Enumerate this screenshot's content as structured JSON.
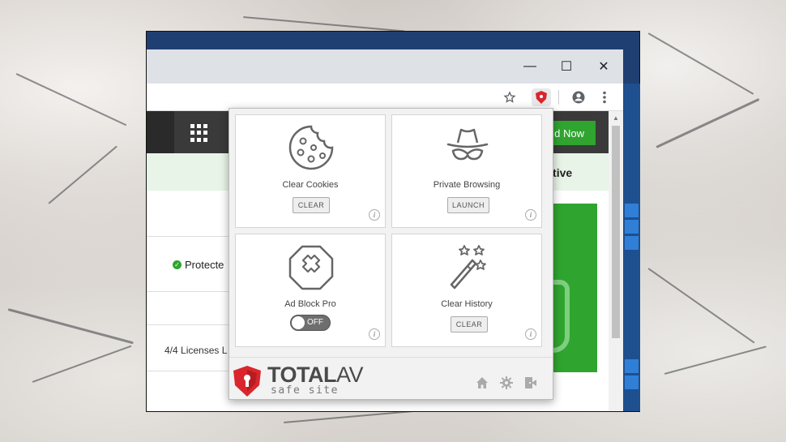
{
  "browser": {
    "window_controls": {
      "minimize": "—",
      "maximize": "☐",
      "close": "✕"
    },
    "toolbar_icons": [
      "star-icon",
      "totalav-extension-icon",
      "account-icon",
      "more-menu-icon"
    ]
  },
  "site": {
    "buy_button_partial": "d Now",
    "status_partial": "s Active",
    "protected_partial": "Protecte",
    "licenses_partial": "4/4 Licenses L"
  },
  "popup": {
    "cards": [
      {
        "label": "Clear Cookies",
        "button": "CLEAR",
        "icon": "cookie-icon"
      },
      {
        "label": "Private Browsing",
        "button": "LAUNCH",
        "icon": "incognito-icon"
      },
      {
        "label": "Ad Block Pro",
        "toggle": "OFF",
        "icon": "ad-block-icon"
      },
      {
        "label": "Clear History",
        "button": "CLEAR",
        "icon": "magic-wand-icon"
      }
    ],
    "info_glyph": "i",
    "brand": {
      "name_main": "TOTAL",
      "name_suffix": "AV",
      "subtitle": "safe site"
    },
    "footer_icons": [
      "home-icon",
      "settings-icon",
      "exit-icon"
    ]
  },
  "colors": {
    "accent_red": "#d9262c",
    "status_green": "#2fa52f"
  }
}
